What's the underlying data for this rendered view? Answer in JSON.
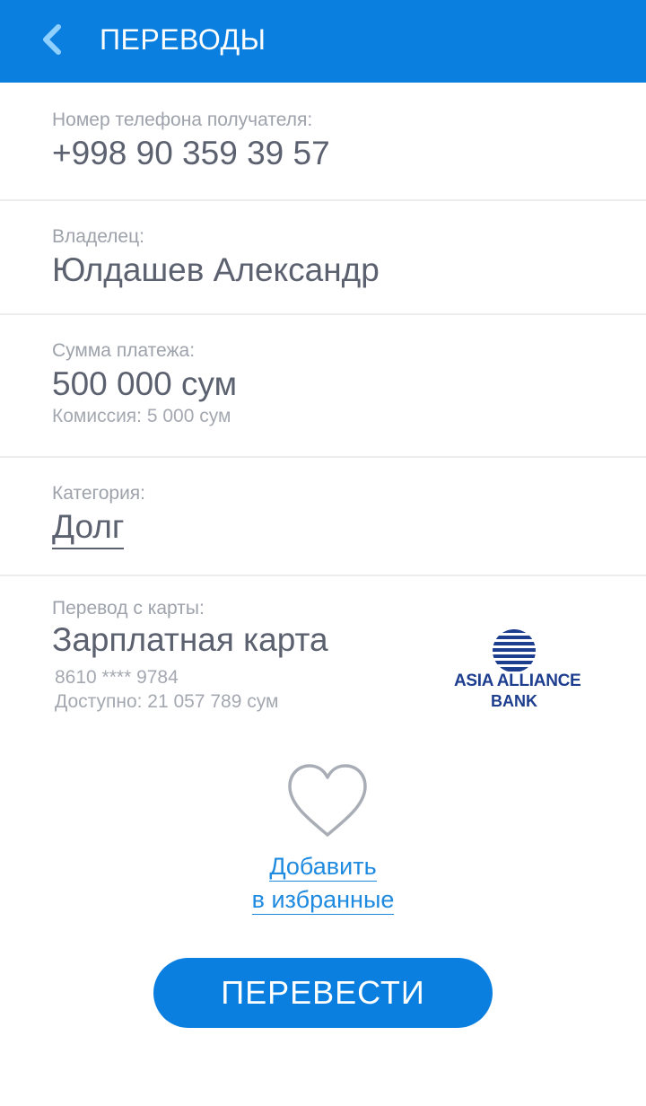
{
  "header": {
    "title": "ПЕРЕВОДЫ",
    "back_icon": "chevron-left-icon"
  },
  "recipient_phone": {
    "label": "Номер телефона получателя:",
    "value": "+998 90 359 39 57"
  },
  "owner": {
    "label": "Владелец:",
    "value": "Юлдашев Александр"
  },
  "amount": {
    "label": "Сумма платежа:",
    "value": "500 000 сум",
    "commission": "Комиссия: 5 000 сум"
  },
  "category": {
    "label": "Категория:",
    "value": "Долг"
  },
  "source_card": {
    "label": "Перевод с карты:",
    "name": "Зарплатная карта",
    "number": "8610 **** 9784",
    "available": "Доступно: 21 057 789 сум",
    "bank_name_line1": "ASIA ALLIANCE",
    "bank_name_line2": "BANK"
  },
  "favorites": {
    "icon": "heart-icon",
    "line1": "Добавить",
    "line2": "в избранные"
  },
  "submit": {
    "label": "ПЕРЕВЕСТИ"
  },
  "colors": {
    "accent": "#0a7fe0",
    "link": "#1e8ae0",
    "bank": "#1d3d8f"
  }
}
